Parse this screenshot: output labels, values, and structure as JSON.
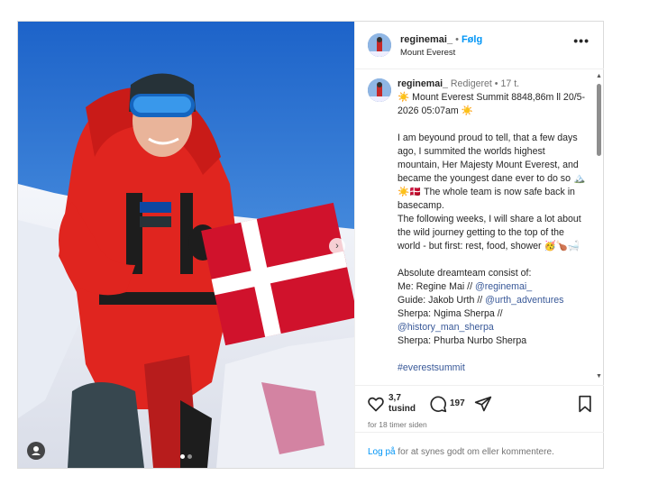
{
  "header": {
    "username": "reginemai_",
    "separator": "•",
    "follow_label": "Følg",
    "location": "Mount Everest",
    "more_icon": "more-horizontal-icon"
  },
  "caption": {
    "username": "reginemai_",
    "edited": "Redigeret",
    "dot": "•",
    "age": "17 t.",
    "line1": "☀️ Mount Everest Summit 8848,86m ll 20/5-2026 05:07am ☀️",
    "para1": "I am beyound proud to tell, that a few days ago, I summited the worlds highest mountain, Her Majesty Mount Everest, and became the youngest dane ever to do so 🏔️☀️🇩🇰 The whole team is now safe back in basecamp.",
    "para2": "The following weeks, I will share a lot about the wild journey getting to the top of the world - but first: rest, food, shower 🥳🍗🛁",
    "team_title": "Absolute dreamteam consist of:",
    "me_prefix": "Me: Regine Mai // ",
    "me_link": "@reginemai_",
    "guide_prefix": "Guide: Jakob Urth // ",
    "guide_link": "@urth_adventures",
    "sherpa1_prefix": "Sherpa: Ngima Sherpa //",
    "sherpa1_link": "@history_man_sherpa",
    "sherpa2": "Sherpa: Phurba Nurbo Sherpa",
    "hashtag": "#everestsummit"
  },
  "actions": {
    "likes_count": "3,7",
    "likes_unit": "tusind",
    "comments_count": "197",
    "timestamp": "for 18 timer siden"
  },
  "login": {
    "link": "Log på",
    "text": " for at synes godt om eller kommentere."
  },
  "photo": {
    "description_icons": [
      "user-tag-icon",
      "next-arrow-icon"
    ],
    "carousel_count": 2,
    "carousel_active": 0
  },
  "colors": {
    "link_blue": "#0095f6",
    "secondary": "#737373",
    "jacket_red": "#e0251f",
    "sky_blue": "#1f73d6"
  }
}
